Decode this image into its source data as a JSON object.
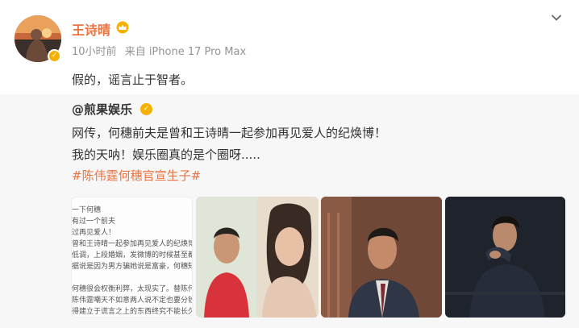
{
  "post": {
    "username": "王诗晴",
    "time": "10小时前",
    "source": "来自 iPhone 17 Pro Max",
    "text": "假的，谣言止于智者。"
  },
  "repost": {
    "author": "@煎果娱乐",
    "line1": "网传，何穗前夫是曾和王诗晴一起参加再见爱人的纪焕博！",
    "line2": "我的天呐！娱乐圈真的是个圈呀.....",
    "hashtag": "#陈伟霆何穗官宣生子#"
  },
  "thumb_text": [
    "一下何穗",
    "有过一个前夫",
    "过再见爱人！",
    "曾和王诗晴一起参加再见爱人的纪焕博",
    "低调，上段婚姻，发微博的时候甚至都",
    "据说是因为男方骗她说是富豪，何穗知",
    "何穗很会权衡利弊，太现实了。替陈伟",
    "陈伟霆嘲天不如意两人说不定也要分钞",
    "得建立于谎言之上的东西终究不能长久"
  ],
  "icons": {
    "avatar": "avatar-photo",
    "verify": "verified-badge-icon",
    "crown": "crown-icon",
    "chevron": "chevron-down-icon"
  },
  "colors": {
    "accent": "#eb7340",
    "verify": "#f6b000",
    "meta": "#939393",
    "repost_bg": "#f7f7f7"
  }
}
